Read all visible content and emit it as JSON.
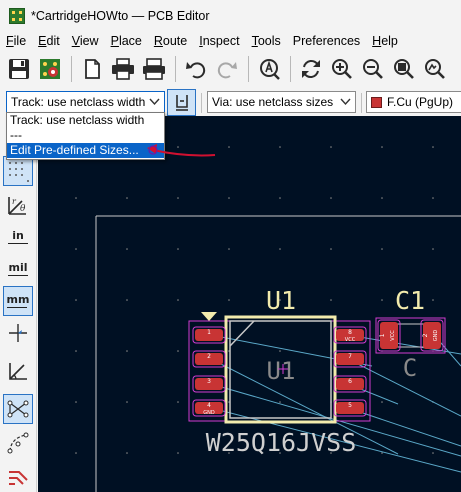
{
  "window": {
    "title": "*CartridgeHOWto — PCB Editor"
  },
  "menu": {
    "items": [
      {
        "mnemonic": "F",
        "rest": "ile"
      },
      {
        "mnemonic": "E",
        "rest": "dit"
      },
      {
        "mnemonic": "V",
        "rest": "iew"
      },
      {
        "mnemonic": "P",
        "rest": "lace"
      },
      {
        "mnemonic": "R",
        "rest": "oute"
      },
      {
        "mnemonic": "I",
        "rest": "nspect"
      },
      {
        "mnemonic": "T",
        "rest": "ools"
      },
      {
        "mnemonic": "",
        "rest": "Preferences"
      },
      {
        "mnemonic": "H",
        "rest": "elp"
      }
    ]
  },
  "toolbar": {
    "icons": [
      "save-icon",
      "board-setup-icon",
      "page-settings-icon",
      "print-icon",
      "plot-icon",
      "undo-icon",
      "redo-icon",
      "find-icon",
      "refresh-icon",
      "zoom-in-icon",
      "zoom-out-icon",
      "zoom-fit-icon",
      "zoom-objects-icon"
    ]
  },
  "track_selector": {
    "value": "Track: use netclass width",
    "options": [
      "Track: use netclass width",
      "---",
      "Edit Pre-defined Sizes..."
    ],
    "highlighted_index": 2
  },
  "via_selector": {
    "value": "Via: use netclass sizes"
  },
  "layer_selector": {
    "value": "F.Cu (PgUp)",
    "color": "#c83434"
  },
  "left_toolbar": {
    "unit_in": "in",
    "unit_mil": "mil",
    "unit_mm": "mm",
    "active_unit": "mm"
  },
  "pcb": {
    "u1_reference": "U1",
    "u1_value_label": "U1",
    "u1_value": "W25Q16JVSS",
    "c1_reference": "C1",
    "c1_value": "C",
    "u1_pad_labels_left": [
      "",
      "",
      "",
      "GND"
    ],
    "u1_pad_labels_right": [
      "VCC",
      "",
      "",
      ""
    ],
    "c1_pad_labels": [
      "VCC",
      "GND"
    ],
    "c1_pad_numbers": [
      "1",
      "2"
    ],
    "u1_pad_numbers_left": [
      "1",
      "2",
      "3",
      "4"
    ],
    "u1_pad_numbers_right": [
      "8",
      "7",
      "6",
      "5"
    ]
  },
  "colors": {
    "canvas_bg": "#001023",
    "silkscreen": "#f2ebad",
    "courtyard": "#c8c8c8",
    "fab_text": "#f2ebad",
    "pad": "#c83434",
    "pad_outline": "#d23cd2",
    "ratsnest": "#5aa8c8",
    "highlight": "#0a64c8",
    "annotation_arrow": "#d01030"
  }
}
